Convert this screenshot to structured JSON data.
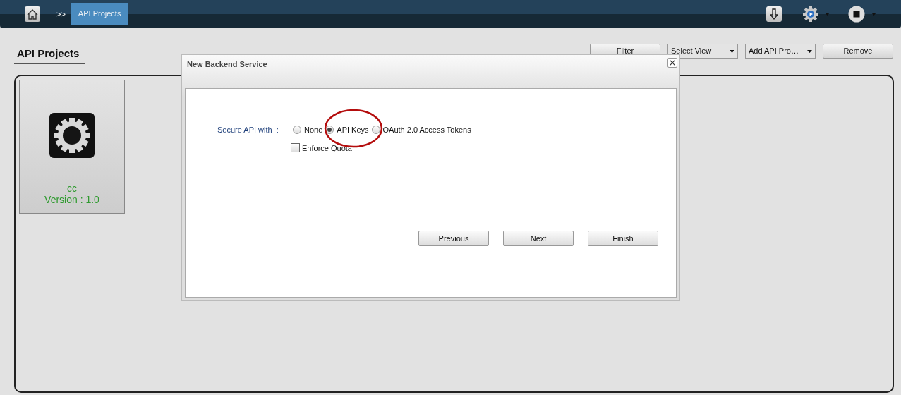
{
  "topbar": {
    "separator": ">>",
    "breadcrumb": "API Projects"
  },
  "page": {
    "title": "API Projects"
  },
  "toolbar": {
    "buttons": [
      {
        "label": "Filter",
        "kind": "button"
      },
      {
        "label": "Select View",
        "kind": "dropdown"
      },
      {
        "label": "Add API Pro…",
        "kind": "dropdown"
      },
      {
        "label": "Remove",
        "kind": "button"
      }
    ]
  },
  "projects": [
    {
      "name": "cc",
      "version": "Version : 1.0"
    }
  ],
  "dialog": {
    "title": "New Backend Service",
    "field_label": "Secure API with  :",
    "options": [
      {
        "label": "None",
        "selected": false
      },
      {
        "label": "API Keys",
        "selected": true
      },
      {
        "label": "OAuth 2.0 Access Tokens",
        "selected": false
      }
    ],
    "enforce_quota": {
      "label": "Enforce Quota",
      "checked": false
    },
    "buttons": [
      "Previous",
      "Next",
      "Finish"
    ]
  }
}
